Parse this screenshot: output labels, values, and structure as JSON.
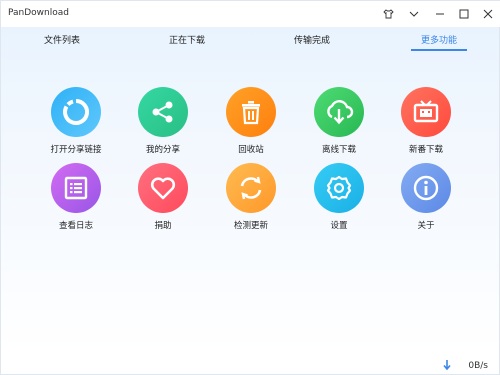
{
  "app": {
    "title": "PanDownload"
  },
  "tabs": [
    {
      "label": "文件列表",
      "active": false
    },
    {
      "label": "正在下载",
      "active": false
    },
    {
      "label": "传输完成",
      "active": false
    },
    {
      "label": "更多功能",
      "active": true
    }
  ],
  "features": [
    {
      "label": "打开分享链接",
      "icon": "refresh-ring-icon",
      "color_from": "#2fb1f6",
      "color_to": "#5fc8fb"
    },
    {
      "label": "我的分享",
      "icon": "share-icon",
      "color_from": "#2fd39c",
      "color_to": "#2fbf84"
    },
    {
      "label": "回收站",
      "icon": "trash-icon",
      "color_from": "#ff9a1f",
      "color_to": "#ff7f0f"
    },
    {
      "label": "离线下载",
      "icon": "cloud-download-icon",
      "color_from": "#48d670",
      "color_to": "#2bbd58"
    },
    {
      "label": "新番下载",
      "icon": "tv-icon",
      "color_from": "#ff6a5a",
      "color_to": "#ff4a3d"
    },
    {
      "label": "查看日志",
      "icon": "list-icon",
      "color_from": "#c866f0",
      "color_to": "#9f58e8"
    },
    {
      "label": "捐助",
      "icon": "heart-icon",
      "color_from": "#ff6a7a",
      "color_to": "#ff4a5f"
    },
    {
      "label": "检测更新",
      "icon": "sync-icon",
      "color_from": "#ffb54a",
      "color_to": "#ff9a2a"
    },
    {
      "label": "设置",
      "icon": "gear-icon",
      "color_from": "#2fc6f2",
      "color_to": "#1fb3e8"
    },
    {
      "label": "关于",
      "icon": "info-icon",
      "color_from": "#7aa4f0",
      "color_to": "#5f8de8"
    }
  ],
  "status": {
    "speed": "0B/s"
  },
  "colors": {
    "accent": "#3b86e6"
  }
}
